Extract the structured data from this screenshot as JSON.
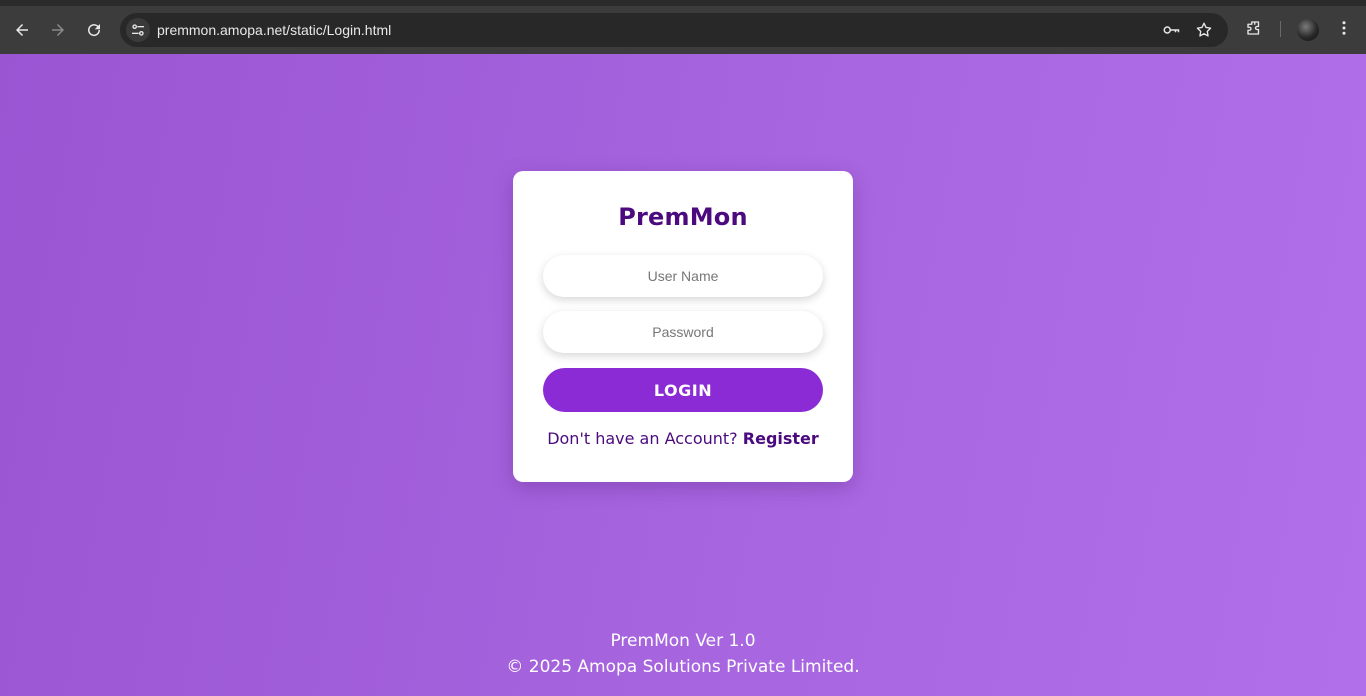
{
  "browser": {
    "url": "premmon.amopa.net/static/Login.html",
    "icons": [
      "back-arrow-icon",
      "forward-arrow-icon",
      "reload-icon",
      "site-info-icon",
      "password-key-icon",
      "bookmark-star-icon",
      "extensions-icon",
      "profile-avatar",
      "more-menu-icon"
    ]
  },
  "login": {
    "title": "PremMon",
    "username_placeholder": "User Name",
    "password_placeholder": "Password",
    "login_label": "LOGIN",
    "no_account_text": "Don't have an Account?",
    "register_label": "Register"
  },
  "footer": {
    "version": "PremMon Ver 1.0",
    "copyright": "© 2025 Amopa Solutions Private Limited."
  },
  "colors": {
    "background_start": "#9a55d3",
    "background_end": "#b170ea",
    "accent": "#8a2bd6",
    "title": "#4b0a7e",
    "card": "#ffffff"
  }
}
